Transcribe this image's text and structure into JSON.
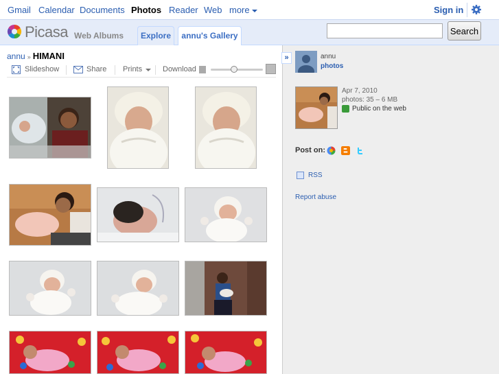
{
  "topnav": {
    "items": [
      {
        "label": "Gmail",
        "active": false
      },
      {
        "label": "Calendar",
        "active": false
      },
      {
        "label": "Documents",
        "active": false
      },
      {
        "label": "Photos",
        "active": true
      },
      {
        "label": "Reader",
        "active": false
      },
      {
        "label": "Web",
        "active": false
      },
      {
        "label": "more",
        "active": false
      }
    ],
    "sign_in": "Sign in",
    "settings_icon": "gear-icon"
  },
  "header": {
    "logo_text": "Picasa",
    "logo_sub": "Web Albums",
    "tabs": [
      {
        "label": "Explore",
        "selected": false
      },
      {
        "label": "annu's Gallery",
        "selected": true
      }
    ],
    "search": {
      "value": "",
      "placeholder": ""
    },
    "search_button": "Search"
  },
  "album": {
    "breadcrumb_user": "annu",
    "breadcrumb_separator": "»",
    "title": "HIMANI",
    "toolbar": {
      "slideshow": "Slideshow",
      "share": "Share",
      "prints": "Prints",
      "download": "Download"
    },
    "thumbnail_size_level": 0.45,
    "photos": [
      {
        "name": "photo-1",
        "icon": "baby-incubator-boy"
      },
      {
        "name": "photo-2",
        "icon": "baby-white-wrap"
      },
      {
        "name": "photo-3",
        "icon": "baby-white-wrap"
      },
      {
        "name": "photo-4",
        "icon": "boy-with-baby-warmer"
      },
      {
        "name": "photo-5",
        "icon": "baby-sleeping"
      },
      {
        "name": "photo-6",
        "icon": "baby-on-white"
      },
      {
        "name": "photo-7",
        "icon": "baby-on-white"
      },
      {
        "name": "photo-8",
        "icon": "baby-on-white"
      },
      {
        "name": "photo-9",
        "icon": "boy-holding-baby"
      },
      {
        "name": "photo-10",
        "icon": "baby-on-red-blanket"
      },
      {
        "name": "photo-11",
        "icon": "baby-on-red-blanket"
      },
      {
        "name": "photo-12",
        "icon": "baby-on-red-blanket"
      }
    ]
  },
  "sidebar": {
    "collapse_label": "»",
    "owner_name": "annu",
    "owner_link": "photos",
    "date": "Apr 7, 2010",
    "count": "photos: 35 – 6 MB",
    "visibility": "Public on the web",
    "post_on_label": "Post on:",
    "post_on_services": [
      "buzz",
      "blogger",
      "twitter"
    ],
    "rss_label": "RSS",
    "report_label": "Report abuse"
  },
  "colors": {
    "link": "#2a5db0",
    "header_bg": "#e5ecf9",
    "sidebar_bg": "#eeeeee"
  }
}
